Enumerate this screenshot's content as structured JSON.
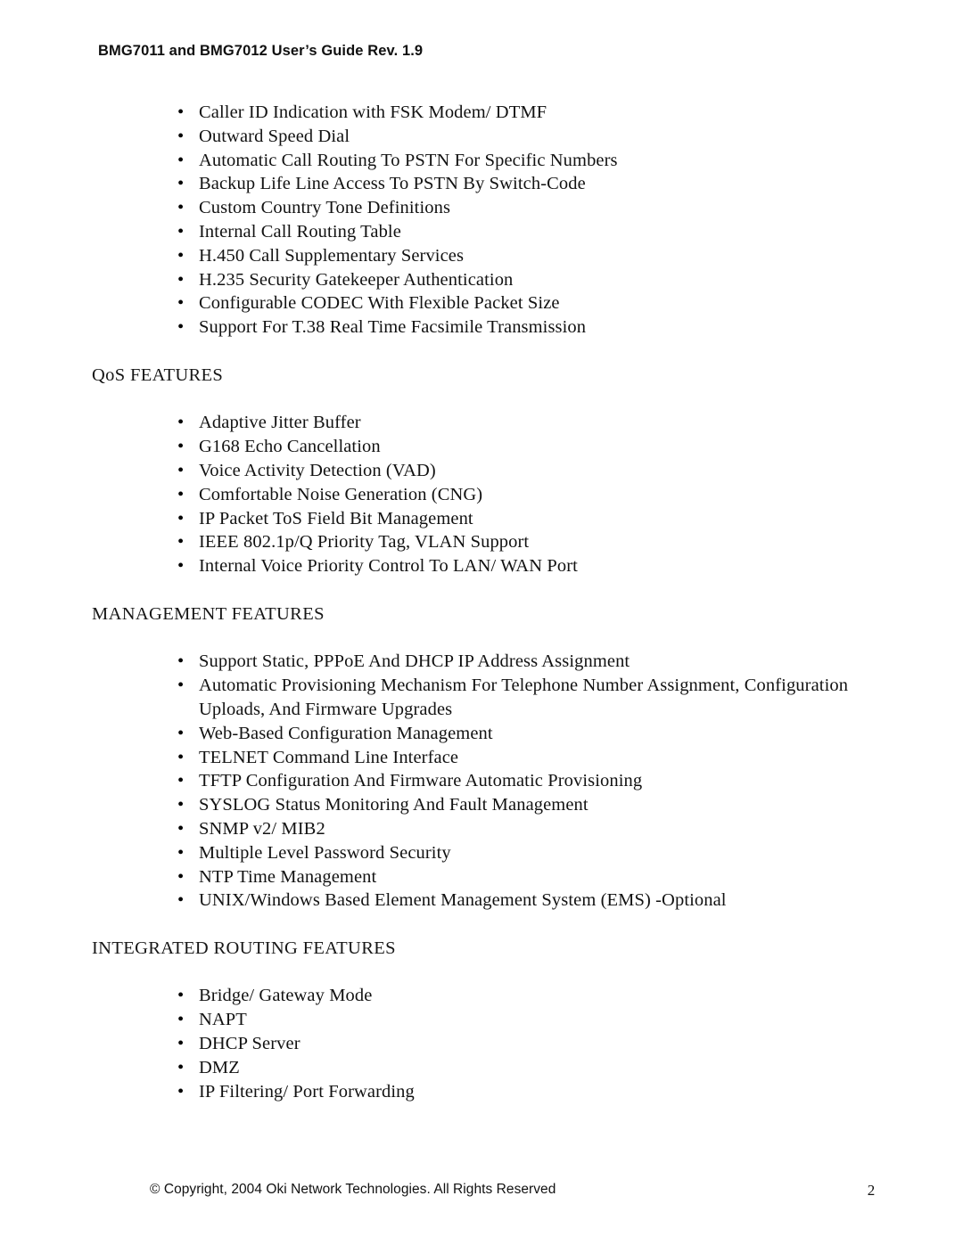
{
  "document": {
    "header": "BMG7011 and BMG7012 User’s Guide Rev. 1.9",
    "bullet_glyph": "•"
  },
  "sections": [
    {
      "heading": null,
      "items": [
        "Caller ID Indication with FSK Modem/ DTMF",
        "Outward Speed Dial",
        "Automatic Call Routing To PSTN For Specific Numbers",
        "Backup Life Line Access To PSTN By Switch-Code",
        "Custom Country Tone Definitions",
        "Internal Call Routing Table",
        "H.450 Call Supplementary Services",
        "H.235 Security Gatekeeper Authentication",
        "Configurable CODEC With Flexible Packet Size",
        "Support For T.38 Real Time Facsimile Transmission"
      ]
    },
    {
      "heading": "QoS FEATURES",
      "items": [
        "Adaptive Jitter Buffer",
        "G168 Echo Cancellation",
        "Voice Activity Detection (VAD)",
        "Comfortable Noise Generation (CNG)",
        "IP Packet ToS Field Bit Management",
        "IEEE 802.1p/Q Priority Tag, VLAN Support",
        "Internal Voice Priority Control To LAN/ WAN Port"
      ]
    },
    {
      "heading": "MANAGEMENT FEATURES",
      "items": [
        "Support Static, PPPoE And DHCP IP Address Assignment",
        "Automatic Provisioning Mechanism For Telephone Number Assignment, Configuration Uploads, And Firmware Upgrades",
        "Web-Based Configuration Management",
        "TELNET Command Line Interface",
        "TFTP Configuration And Firmware Automatic Provisioning",
        "SYSLOG Status Monitoring And Fault Management",
        "SNMP v2/ MIB2",
        "Multiple Level Password Security",
        "NTP Time Management",
        "UNIX/Windows Based Element Management System (EMS) -Optional"
      ]
    },
    {
      "heading": "INTEGRATED ROUTING FEATURES",
      "items": [
        "Bridge/ Gateway Mode",
        "NAPT",
        "DHCP Server",
        "DMZ",
        "IP Filtering/ Port Forwarding"
      ]
    }
  ],
  "footer": {
    "copyright": "© Copyright, 2004 Oki Network Technologies. All Rights Reserved",
    "page_number": "2"
  }
}
